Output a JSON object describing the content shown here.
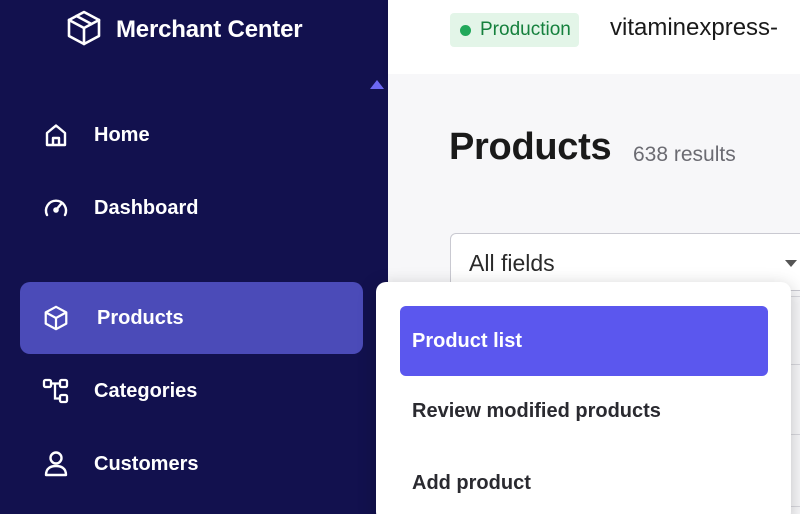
{
  "app": {
    "title": "Merchant Center"
  },
  "sidebar": {
    "items": [
      {
        "label": "Home",
        "icon": "home-icon"
      },
      {
        "label": "Dashboard",
        "icon": "speedometer-icon"
      },
      {
        "label": "Products",
        "icon": "cube-icon",
        "active": true
      },
      {
        "label": "Categories",
        "icon": "hierarchy-icon"
      },
      {
        "label": "Customers",
        "icon": "user-icon"
      }
    ]
  },
  "topbar": {
    "environment": "Production",
    "project": "vitaminexpress-"
  },
  "main": {
    "title": "Products",
    "results": "638 results",
    "search_field": {
      "value": "All fields"
    }
  },
  "flyout": {
    "items": [
      {
        "label": "Product list",
        "active": true
      },
      {
        "label": "Review modified products"
      },
      {
        "label": "Add product"
      }
    ]
  },
  "colors": {
    "sidebar_bg": "#12114e",
    "active_nav_bg": "#4b4bb8",
    "accent": "#5b57ee",
    "env_badge_bg": "#e3f5e8",
    "env_text": "#15803d"
  }
}
